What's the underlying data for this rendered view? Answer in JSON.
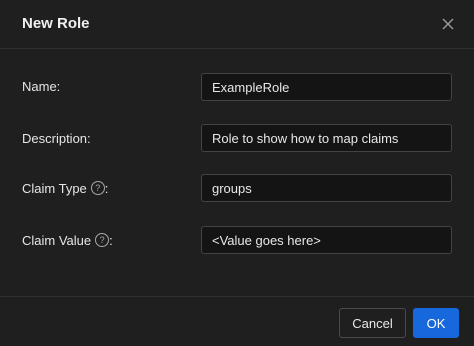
{
  "dialog": {
    "title": "New Role",
    "close_icon": "close-icon"
  },
  "form": {
    "name": {
      "label": "Name:",
      "value": "ExampleRole"
    },
    "description": {
      "label": "Description:",
      "value": "Role to show how to map claims"
    },
    "claim_type": {
      "label": "Claim Type",
      "suffix": ":",
      "help_icon": "question-circle-icon",
      "value": "groups"
    },
    "claim_value": {
      "label": "Claim Value",
      "suffix": ":",
      "help_icon": "question-circle-icon",
      "value": "<Value goes here>"
    }
  },
  "footer": {
    "cancel_label": "Cancel",
    "ok_label": "OK"
  },
  "colors": {
    "background": "#1f1f1f",
    "primary": "#1668dc",
    "input_bg": "#141414",
    "border": "#434343"
  }
}
